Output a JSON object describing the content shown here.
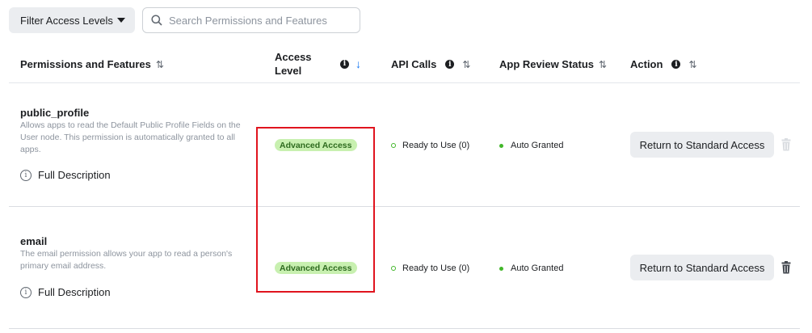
{
  "toolbar": {
    "filter_label": "Filter Access Levels",
    "search_placeholder": "Search Permissions and Features"
  },
  "table": {
    "columns": {
      "permissions": "Permissions and Features",
      "access_level": "Access Level",
      "api_calls": "API Calls",
      "app_review": "App Review Status",
      "action": "Action"
    },
    "rows": [
      {
        "name": "public_profile",
        "description": "Allows apps to read the Default Public Profile Fields on the User node. This permission is automatically granted to all apps.",
        "full_description": "Full Description",
        "access_level": "Advanced Access",
        "api_status": "Ready to Use (0)",
        "review_status": "Auto Granted",
        "action_label": "Return to Standard Access",
        "trash_state": "disabled"
      },
      {
        "name": "email",
        "description": "The email permission allows your app to read a person's primary email address.",
        "full_description": "Full Description",
        "access_level": "Advanced Access",
        "api_status": "Ready to Use (0)",
        "review_status": "Auto Granted",
        "action_label": "Return to Standard Access",
        "trash_state": "enabled"
      }
    ]
  },
  "colors": {
    "badge_bg": "#c8f0b0",
    "badge_text": "#2e6b1f",
    "status_green": "#42b72a",
    "highlight": "#e0141e",
    "sort_active": "#1877f2"
  },
  "icons": {
    "filter_caret": "caret-down-icon",
    "search": "search-icon",
    "sort": "sort-icon",
    "sort_active": "arrow-down-icon",
    "info": "info-icon",
    "full_description": "info-circle-icon",
    "trash": "trash-icon"
  }
}
